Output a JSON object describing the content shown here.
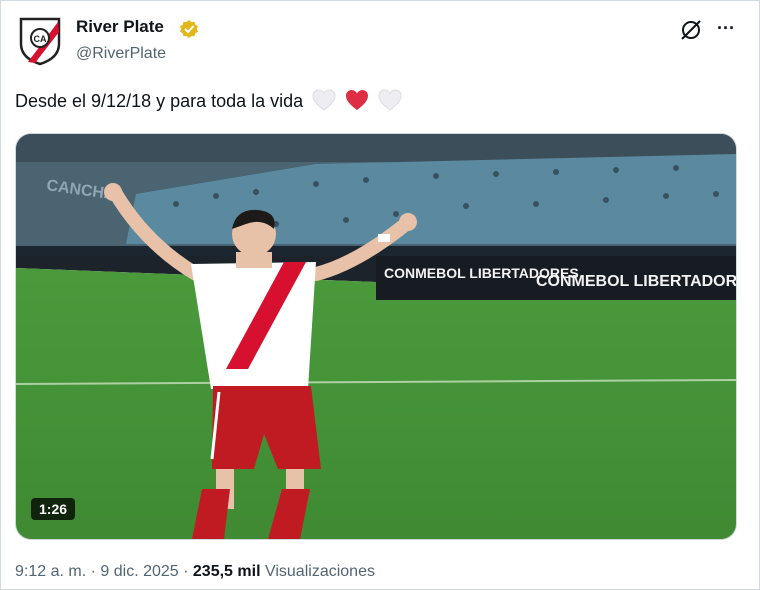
{
  "account": {
    "display_name": "River Plate",
    "handle": "@RiverPlate",
    "avatar_icon": "river-plate-crest",
    "verified_icon": "verified-badge-gold"
  },
  "tweet": {
    "text": "Desde el 9/12/18 y para toda la vida",
    "emojis": [
      "white-heart",
      "red-heart",
      "white-heart"
    ]
  },
  "media": {
    "type": "video",
    "duration": "1:26",
    "banner_left": "CONMEBOL LIBERTADORES",
    "banner_right": "CONMEBOL LIBERTADORES",
    "stand_sign": "CANCHA"
  },
  "meta": {
    "time": "9:12 a. m.",
    "separator": "·",
    "date": "9 dic. 2025",
    "views_count": "235,5 mil",
    "views_label": "Visualizaciones"
  },
  "colors": {
    "brand_red": "#d6102e",
    "verified_gold": "#e2b719",
    "text_primary": "#0f1419",
    "text_secondary": "#536471",
    "border": "#cfd9de"
  }
}
